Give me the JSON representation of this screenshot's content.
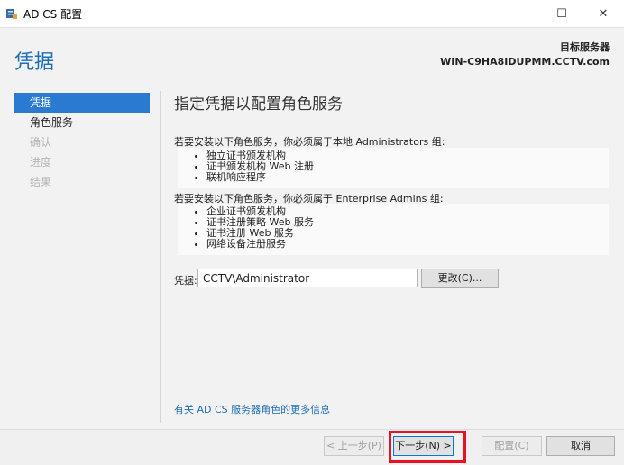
{
  "window": {
    "title": "AD CS 配置",
    "minimize_glyph": "—",
    "maximize_glyph": "☐",
    "close_glyph": "✕"
  },
  "header": {
    "page_title": "凭据",
    "destination_label": "目标服务器",
    "destination_server": "WIN-C9HA8IDUPMM.CCTV.com"
  },
  "nav": {
    "items": [
      {
        "label": "凭据",
        "state": "active"
      },
      {
        "label": "角色服务",
        "state": "normal"
      },
      {
        "label": "确认",
        "state": "disabled"
      },
      {
        "label": "进度",
        "state": "disabled"
      },
      {
        "label": "结果",
        "state": "disabled"
      }
    ]
  },
  "main": {
    "title": "指定凭据以配置角色服务",
    "admins_intro": "若要安装以下角色服务，你必须属于本地 Administrators 组:",
    "admins_items": [
      "独立证书颁发机构",
      "证书颁发机构 Web 注册",
      "联机响应程序"
    ],
    "enterprise_intro": "若要安装以下角色服务，你必须属于 Enterprise Admins 组:",
    "enterprise_items": [
      "企业证书颁发机构",
      "证书注册策略 Web 服务",
      "证书注册 Web 服务",
      "网络设备注册服务"
    ],
    "credential_label": "凭据:",
    "credential_value": "CCTV\\Administrator",
    "change_button": "更改(C)...",
    "more_info_link": "有关 AD CS 服务器角色的更多信息"
  },
  "footer": {
    "prev": "< 上一步(P)",
    "next": "下一步(N) >",
    "install": "配置(C)",
    "cancel": "取消"
  },
  "colors": {
    "accent": "#1e6fb5",
    "nav_active_bg": "#2a7ad2",
    "highlight": "#e81123"
  }
}
